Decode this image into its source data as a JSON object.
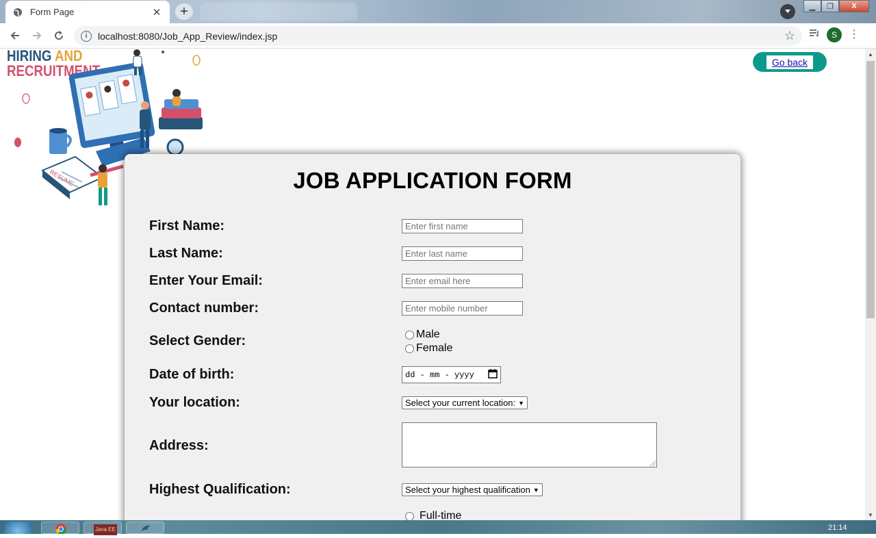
{
  "browser": {
    "tab_title": "Form Page",
    "url": "localhost:8080/Job_App_Review/index.jsp",
    "profile_initial": "S"
  },
  "logo": {
    "line1_a": "HIRING",
    "line1_b": "AND",
    "line2": "RECRUITMENT"
  },
  "go_back_label": "Go back",
  "form": {
    "title": "JOB APPLICATION FORM",
    "first_name": {
      "label": "First Name:",
      "placeholder": "Enter first name"
    },
    "last_name": {
      "label": "Last Name:",
      "placeholder": "Enter last name"
    },
    "email": {
      "label": "Enter Your Email:",
      "placeholder": "Enter email here"
    },
    "contact": {
      "label": "Contact number:",
      "placeholder": "Enter mobile number"
    },
    "gender": {
      "label": "Select Gender:",
      "options": [
        "Male",
        "Female"
      ]
    },
    "dob": {
      "label": "Date of birth:",
      "placeholder": "dd - mm - yyyy"
    },
    "location": {
      "label": "Your location:",
      "selected": "Select your current location:"
    },
    "address": {
      "label": "Address:"
    },
    "qualification": {
      "label": "Highest Qualification:",
      "selected": "Select your highest qualification"
    },
    "job_type": {
      "options": [
        "Full-time"
      ]
    }
  },
  "taskbar": {
    "javaee_label": "Java EE",
    "clock": "21:14"
  },
  "colors": {
    "go_back_pill": "#0e9a8a",
    "card_bg": "#f0f0f0",
    "logo_blue": "#27557a",
    "logo_pink": "#d4506a"
  }
}
